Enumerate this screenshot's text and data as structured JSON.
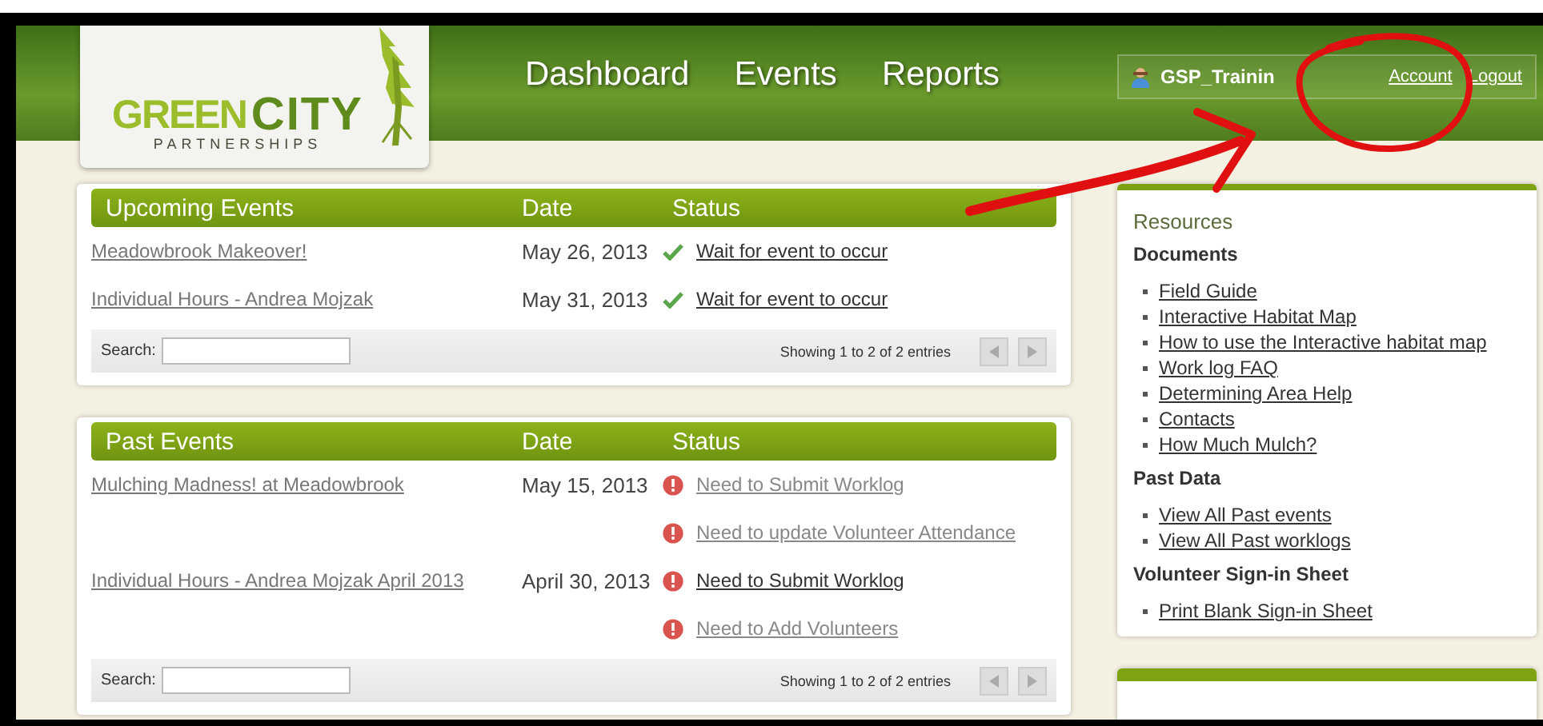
{
  "header": {
    "logo": {
      "word_1": "GREEN",
      "word_2": "CITY",
      "tagline": "PARTNERSHIPS"
    },
    "nav": [
      "Dashboard",
      "Events",
      "Reports"
    ],
    "user": {
      "name": "GSP_Trainin",
      "links": [
        "Account",
        "Logout"
      ]
    }
  },
  "tables": [
    {
      "title": "Upcoming Events",
      "columns": [
        "Date",
        "Status"
      ],
      "rows": [
        {
          "event": "Meadowbrook Makeover!",
          "date": "May 26, 2013",
          "statuses": [
            {
              "kind": "ok",
              "text": "Wait for event to occur",
              "visited": true
            }
          ]
        },
        {
          "event": "Individual Hours - Andrea Mojzak",
          "date": "May 31, 2013",
          "statuses": [
            {
              "kind": "ok",
              "text": "Wait for event to occur",
              "visited": true
            }
          ]
        }
      ],
      "search_label": "Search:",
      "info": "Showing 1 to 2 of 2 entries"
    },
    {
      "title": "Past Events",
      "columns": [
        "Date",
        "Status"
      ],
      "rows": [
        {
          "event": "Mulching Madness! at Meadowbrook",
          "date": "May 15, 2013",
          "statuses": [
            {
              "kind": "alert",
              "text": "Need to Submit Worklog",
              "visited": false
            },
            {
              "kind": "alert",
              "text": "Need to update Volunteer Attendance",
              "visited": false
            }
          ]
        },
        {
          "event": "Individual Hours - Andrea Mojzak April 2013",
          "date": "April 30, 2013",
          "statuses": [
            {
              "kind": "alert",
              "text": "Need to Submit Worklog",
              "visited": true
            },
            {
              "kind": "alert",
              "text": "Need to Add Volunteers",
              "visited": false
            }
          ]
        }
      ],
      "search_label": "Search:",
      "info": "Showing 1 to 2 of 2 entries"
    }
  ],
  "resources": {
    "title": "Resources",
    "sections": [
      {
        "heading": "Documents",
        "links": [
          "Field Guide",
          "Interactive Habitat Map",
          "How to use the Interactive habitat map",
          "Work log FAQ",
          "Determining Area Help",
          "Contacts",
          "How Much Mulch?"
        ]
      },
      {
        "heading": "Past Data",
        "links": [
          "View All Past events",
          "View All Past worklogs"
        ]
      },
      {
        "heading": "Volunteer Sign-in Sheet",
        "links": [
          "Print Blank Sign-in Sheet"
        ]
      }
    ]
  }
}
